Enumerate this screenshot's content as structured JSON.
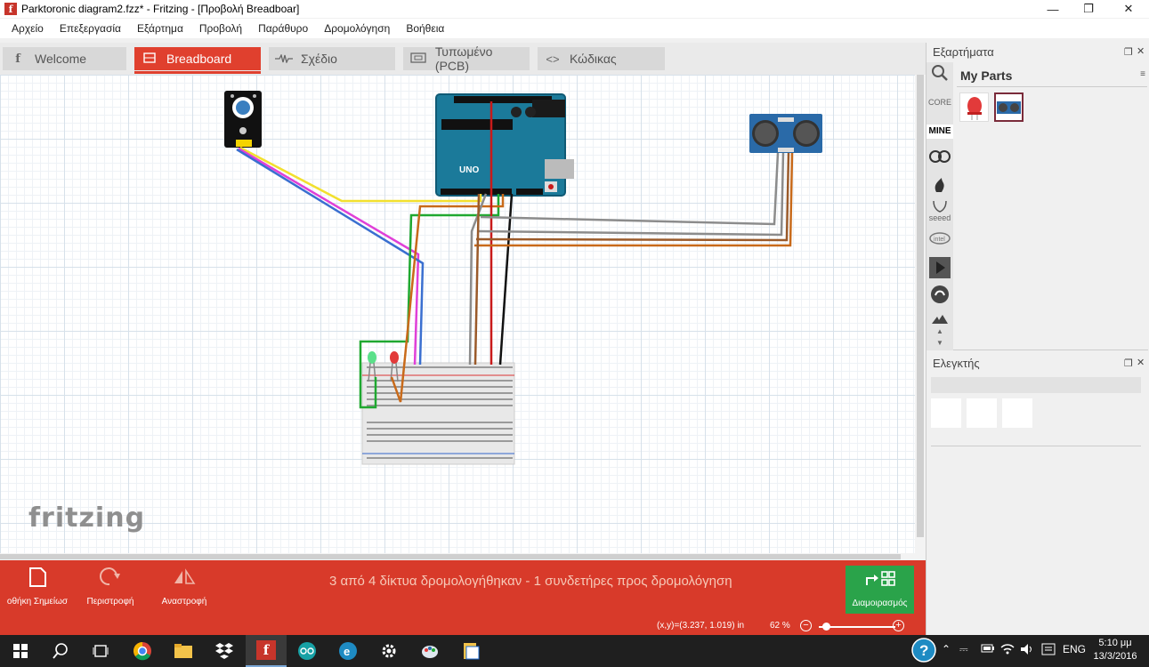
{
  "window": {
    "title": "Parktoronic diagram2.fzz* - Fritzing - [Προβολή Breadboar]",
    "controls": [
      "minimize",
      "restore",
      "close"
    ]
  },
  "menu": [
    "Αρχείο",
    "Επεξεργασία",
    "Εξάρτημα",
    "Προβολή",
    "Παράθυρο",
    "Δρομολόγηση",
    "Βοήθεια"
  ],
  "tabs": [
    {
      "label": "Welcome",
      "icon": "fritzing-f-icon"
    },
    {
      "label": "Breadboard",
      "icon": "breadboard-icon",
      "active": true
    },
    {
      "label": "Σχέδιο",
      "icon": "schematic-icon"
    },
    {
      "label": "Τυπωμένο (PCB)",
      "icon": "pcb-icon"
    },
    {
      "label": "Κώδικας",
      "icon": "code-icon"
    }
  ],
  "canvas": {
    "watermark": "fritzing",
    "parts": [
      "sensor-module",
      "arduino-uno",
      "ultrasonic-sensor",
      "breadboard",
      "green-led",
      "red-led"
    ],
    "arduino_label": "UNO",
    "wire_colors": {
      "yellow": "#f2e02e",
      "pink": "#e040d8",
      "blue": "#3a6fd0",
      "green": "#1fa830",
      "orange": "#c86a1a",
      "red": "#c81a1a",
      "black": "#111111",
      "gray": "#8c8c8c",
      "brown": "#9a5a2a"
    }
  },
  "toolbar": {
    "tools": [
      {
        "label": "οθήκη Σημείωσ",
        "icon": "note-icon"
      },
      {
        "label": "Περιστροφή",
        "icon": "rotate-icon"
      },
      {
        "label": "Αναστροφή",
        "icon": "flip-icon"
      }
    ],
    "status": "3 από 4 δίκτυα δρομολογήθηκαν - 1 συνδετήρες προς δρομολόγηση",
    "route_button": {
      "label": "Διαμοιρασμός",
      "icon": "share-icon"
    }
  },
  "statusbar": {
    "coords": "(x,y)=(3.237, 1.019) in",
    "zoom": "62 %",
    "zoom_level": 0.62
  },
  "parts_panel": {
    "title": "Εξαρτήματα",
    "bins": [
      {
        "label": "CORE",
        "icon": "core-bin"
      },
      {
        "label": "MINE",
        "icon": "mine-bin",
        "active": true
      },
      {
        "label": "",
        "icon": "arduino-bin-icon"
      },
      {
        "label": "",
        "icon": "sparkfun-bin-icon"
      },
      {
        "label": "seeed",
        "icon": "seeed-bin-icon"
      },
      {
        "label": "intel",
        "icon": "intel-bin-icon"
      },
      {
        "label": "",
        "icon": "play-bin-icon"
      },
      {
        "label": "",
        "icon": "snootlab-bin-icon"
      }
    ],
    "bin_title": "My Parts",
    "parts": [
      {
        "name": "red-led",
        "selected": false
      },
      {
        "name": "ultrasonic-sensor",
        "selected": true
      }
    ]
  },
  "inspector": {
    "title": "Ελεγκτής"
  },
  "taskbar": {
    "apps": [
      "start",
      "search",
      "task-view",
      "chrome",
      "explorer",
      "dropbox",
      "fritzing",
      "arduino",
      "edge-like",
      "settings",
      "paint",
      "files"
    ],
    "lang": "ENG",
    "time": "5:10 μμ",
    "date": "13/3/2016"
  }
}
